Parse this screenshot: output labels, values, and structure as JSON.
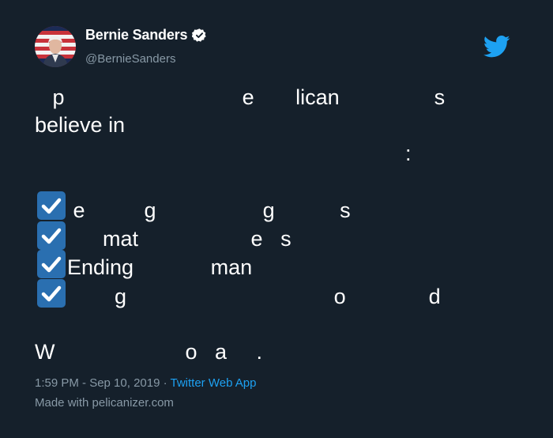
{
  "author": {
    "display_name": "Bernie Sanders",
    "handle": "@BernieSanders"
  },
  "icons": {
    "avatar": "avatar-photo",
    "verified": "verified-badge-icon",
    "brand": "twitter-bird-icon",
    "check": "check-box-icon"
  },
  "colors": {
    "background": "#15202b",
    "text": "#ffffff",
    "muted": "#8899a6",
    "link": "#1da1f2",
    "check_box": "#2a6fb0"
  },
  "tweet": {
    "line1": "   p                              e       lican                s",
    "line2": "believe in",
    "line3": ":",
    "check1": " e          g                  g           s",
    "check2": "      mat                   e   s",
    "check3": "Ending             man",
    "check4": "        g                                   o              d",
    "closing": "W                      o   a     ."
  },
  "footer": {
    "time": "1:59 PM - Sep 10, 2019",
    "separator": " · ",
    "app": "Twitter Web App",
    "made_with": "Made with pelicanizer.com"
  }
}
